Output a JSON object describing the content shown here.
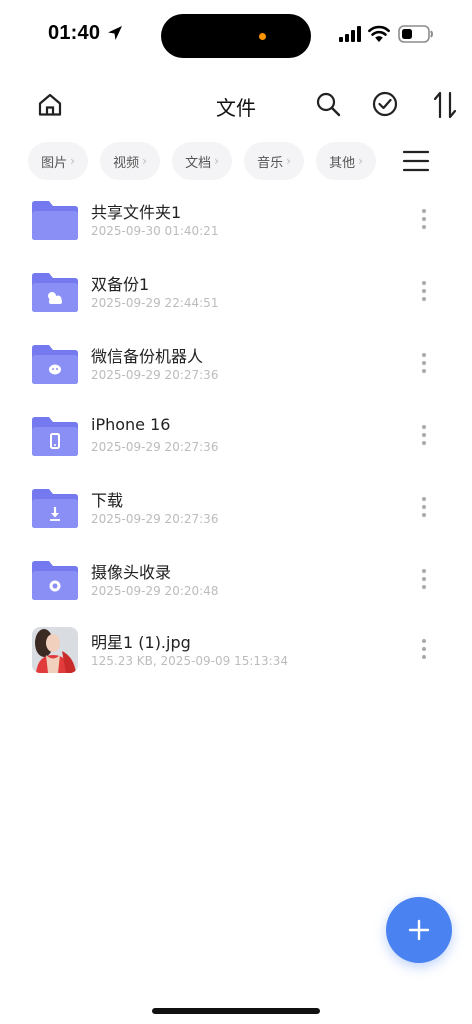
{
  "status_bar": {
    "time": "01:40"
  },
  "header": {
    "title": "文件",
    "icons": [
      "home-icon",
      "search-icon",
      "select-all-icon",
      "sort-icon"
    ]
  },
  "categories": [
    {
      "label": "图片"
    },
    {
      "label": "视频"
    },
    {
      "label": "文档"
    },
    {
      "label": "音乐"
    },
    {
      "label": "其他"
    }
  ],
  "files": [
    {
      "name": "共享文件夹1",
      "meta": "2025-09-30 01:40:21",
      "icon": "shared-folder-icon"
    },
    {
      "name": "双备份1",
      "meta": "2025-09-29 22:44:51",
      "icon": "backup-folder-icon"
    },
    {
      "name": "微信备份机器人",
      "meta": "2025-09-29 20:27:36",
      "icon": "wechat-folder-icon"
    },
    {
      "name": "iPhone 16",
      "meta": "2025-09-29 20:27:36",
      "icon": "phone-folder-icon"
    },
    {
      "name": "下载",
      "meta": "2025-09-29 20:27:36",
      "icon": "download-folder-icon"
    },
    {
      "name": "摄像头收录",
      "meta": "2025-09-29 20:20:48",
      "icon": "camera-folder-icon"
    },
    {
      "name": "明星1 (1).jpg",
      "meta": "125.23 KB, 2025-09-09 15:13:34",
      "icon": "image-thumbnail"
    }
  ],
  "colors": {
    "folder": "#8a8ff5",
    "folder_dark": "#7479ef",
    "accent": "#4a82f1",
    "meta_text": "#bcbcbc"
  }
}
